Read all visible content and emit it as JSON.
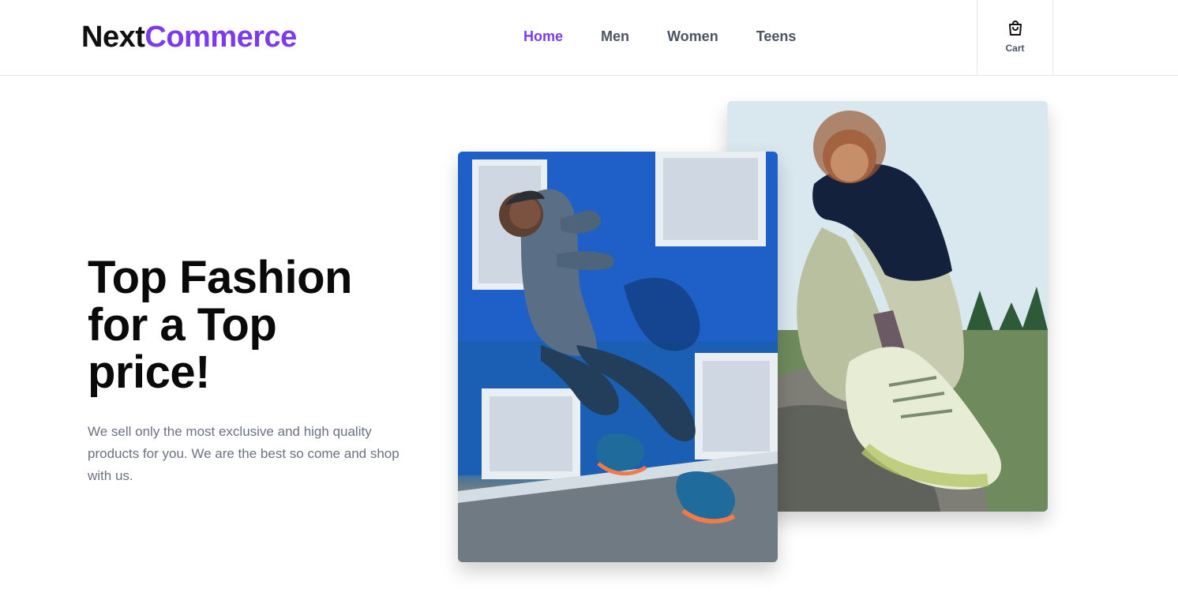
{
  "brand": {
    "part1": "Next",
    "part2": "Commerce",
    "accent": "#7c3aed"
  },
  "nav": {
    "items": [
      {
        "label": "Home",
        "active": true
      },
      {
        "label": "Men",
        "active": false
      },
      {
        "label": "Women",
        "active": false
      },
      {
        "label": "Teens",
        "active": false
      }
    ]
  },
  "cart": {
    "label": "Cart",
    "icon": "shopping-bag-icon"
  },
  "hero": {
    "title_line1": "Top Fashion",
    "title_line2": "for a Top",
    "title_line3": "price!",
    "description": "We sell only the most exclusive and high quality products for you. We are the best so come and shop with us."
  }
}
